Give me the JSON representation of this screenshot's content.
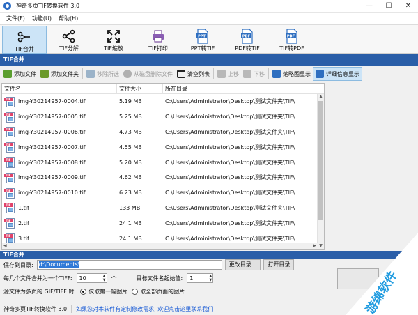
{
  "window": {
    "title": "神奇多页TIF转换软件 3.0",
    "controls": [
      "—",
      "☐",
      "✕"
    ]
  },
  "menu": [
    "文件(F)",
    "功能(U)",
    "帮助(H)"
  ],
  "toolbar": [
    {
      "label": "TIF合并",
      "icon": "merge-icon",
      "active": true
    },
    {
      "label": "TIF分解",
      "icon": "split-icon",
      "active": false
    },
    {
      "label": "TIF缩放",
      "icon": "resize-icon",
      "active": false
    },
    {
      "label": "TIF打印",
      "icon": "printer-icon",
      "active": false
    },
    {
      "label": "PPT转TIF",
      "icon": "ppt-file-icon",
      "badge": "PPT",
      "active": false
    },
    {
      "label": "PDF转TIF",
      "icon": "pdf-file-icon",
      "badge": "PDF",
      "active": false
    },
    {
      "label": "TIF转PDF",
      "icon": "pdf-file-icon",
      "badge": "PDF",
      "active": false
    }
  ],
  "section_title": "TIF合并",
  "actions": [
    {
      "label": "添加文件",
      "icon": "add-file-icon",
      "enabled": true,
      "color": "#5a9e2f"
    },
    {
      "label": "添加文件夹",
      "icon": "add-folder-icon",
      "enabled": true,
      "color": "#6b9a2a"
    },
    {
      "label": "移除所选",
      "icon": "remove-icon",
      "enabled": false,
      "color": "#9bb3c9"
    },
    {
      "label": "从磁盘删除文件",
      "icon": "delete-disk-icon",
      "enabled": false,
      "color": "#b0b0b0"
    },
    {
      "label": "清空列表",
      "icon": "trash-icon",
      "enabled": true,
      "color": "#222222"
    },
    {
      "label": "上移",
      "icon": "up-icon",
      "enabled": false,
      "color": "#b8b8b8"
    },
    {
      "label": "下移",
      "icon": "down-icon",
      "enabled": false,
      "color": "#b8b8b8"
    },
    {
      "label": "缩略图显示",
      "icon": "thumbnail-icon",
      "enabled": true,
      "color": "#2f6fc0"
    },
    {
      "label": "详细信息显示",
      "icon": "details-icon",
      "enabled": true,
      "color": "#2f6fc0",
      "selected": true
    }
  ],
  "table": {
    "columns": [
      "文件名",
      "文件大小",
      "所在目录"
    ],
    "rows": [
      {
        "name": "img-Y30214957-0004.tif",
        "size": "5.19 MB",
        "dir": "C:\\Users\\Administrator\\Desktop\\测试文件夹\\TIF\\"
      },
      {
        "name": "img-Y30214957-0005.tif",
        "size": "5.25 MB",
        "dir": "C:\\Users\\Administrator\\Desktop\\测试文件夹\\TIF\\"
      },
      {
        "name": "img-Y30214957-0006.tif",
        "size": "4.73 MB",
        "dir": "C:\\Users\\Administrator\\Desktop\\测试文件夹\\TIF\\"
      },
      {
        "name": "img-Y30214957-0007.tif",
        "size": "4.55 MB",
        "dir": "C:\\Users\\Administrator\\Desktop\\测试文件夹\\TIF\\"
      },
      {
        "name": "img-Y30214957-0008.tif",
        "size": "5.20 MB",
        "dir": "C:\\Users\\Administrator\\Desktop\\测试文件夹\\TIF\\"
      },
      {
        "name": "img-Y30214957-0009.tif",
        "size": "4.62 MB",
        "dir": "C:\\Users\\Administrator\\Desktop\\测试文件夹\\TIF\\"
      },
      {
        "name": "img-Y30214957-0010.tif",
        "size": "6.23 MB",
        "dir": "C:\\Users\\Administrator\\Desktop\\测试文件夹\\TIF\\"
      },
      {
        "name": "1.tif",
        "size": "133 MB",
        "dir": "C:\\Users\\Administrator\\Desktop\\测试文件夹\\TIF\\"
      },
      {
        "name": "2.tif",
        "size": "24.1 MB",
        "dir": "C:\\Users\\Administrator\\Desktop\\测试文件夹\\TIF\\"
      },
      {
        "name": "3.tif",
        "size": "24.1 MB",
        "dir": "C:\\Users\\Administrator\\Desktop\\测试文件夹\\TIF\\"
      }
    ],
    "file_badge": "TIF"
  },
  "section2_title": "TIF合并",
  "options": {
    "save_dir_label": "保存到目录:",
    "save_dir_value": "d:\\Documents\\",
    "change_dir_button": "更改目录...",
    "open_dir_button": "打开目录",
    "merge_count_label": "每几个文件合并为一个TIFF:",
    "merge_count_value": "10",
    "merge_count_unit": "个",
    "start_value_label": "目标文件名起始值:",
    "start_value_value": "1",
    "multipage_label": "源文件为多页的 GIF/TIFF 时:",
    "radio_first_page": "仅取第一幅图片",
    "radio_all_pages": "取全部页面的图片",
    "radio_selected": "first"
  },
  "status": {
    "app_name": "神奇多页TIF转换软件 3.0",
    "notice": "如果您对本软件有定制修改需求, 欢迎点击这里联系我们"
  },
  "watermark": {
    "text": "游绵软件",
    "color": "#1f9be0"
  }
}
